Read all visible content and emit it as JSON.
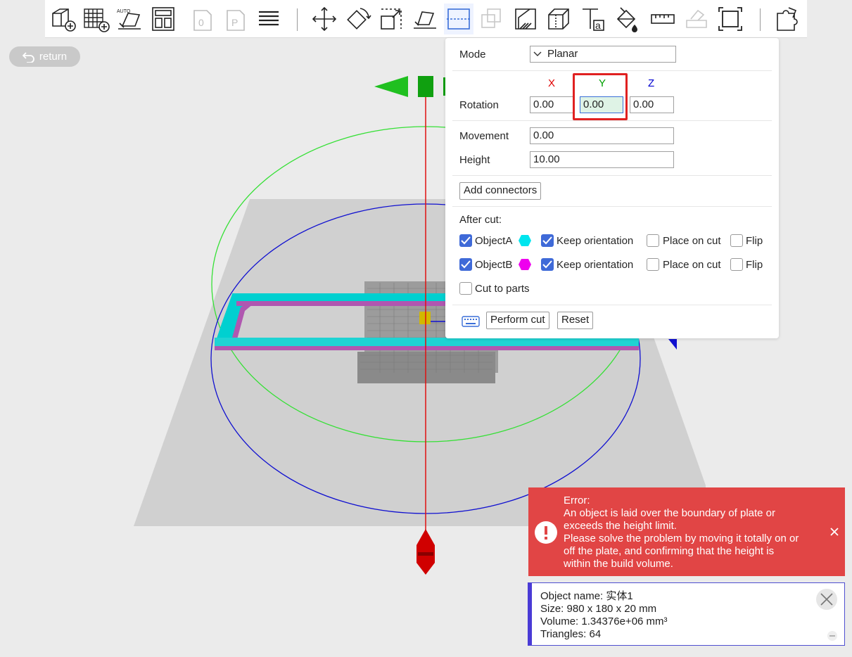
{
  "return_label": "return",
  "cut_panel": {
    "mode_label": "Mode",
    "mode_value": "Planar",
    "axes": {
      "x": "X",
      "y": "Y",
      "z": "Z"
    },
    "axis_colors": {
      "x": "#e00000",
      "y": "#00a000",
      "z": "#0000d0"
    },
    "rotation_label": "Rotation",
    "rotation": {
      "x": "0.00",
      "y": "0.00",
      "z": "0.00"
    },
    "movement_label": "Movement",
    "movement_value": "0.00",
    "height_label": "Height",
    "height_value": "10.00",
    "add_connectors": "Add connectors",
    "after_cut_label": "After cut:",
    "object_a": "ObjectA",
    "object_b": "ObjectB",
    "object_a_color": "#00e5ee",
    "object_b_color": "#ee00ee",
    "keep_orientation": "Keep orientation",
    "place_on_cut": "Place on cut",
    "flip": "Flip",
    "cut_to_parts": "Cut to parts",
    "perform_cut": "Perform cut",
    "reset": "Reset"
  },
  "error": {
    "title": "Error:",
    "line1": "An object is laid over the boundary of plate or",
    "line2": "exceeds the height limit.",
    "line3": "Please solve the problem by moving it totally on or",
    "line4": "off the plate, and confirming that the height is",
    "line5": "within the build volume.",
    "icon": "exclamation-icon",
    "color": "#e14545"
  },
  "object_info": {
    "name": "Object name: 实体1",
    "size": "Size: 980 x 180 x 20 mm",
    "volume": "Volume: 1.34376e+06 mm³",
    "triangles": "Triangles: 64"
  },
  "toolbar_icons": [
    "add-object-icon",
    "add-plate-icon",
    "auto-orient-icon",
    "arrange-icon",
    "layer-0-icon",
    "layer-p-icon",
    "layers-icon",
    "move-icon",
    "rotate-icon",
    "scale-icon",
    "lay-on-face-icon",
    "cut-icon",
    "boolean-icon",
    "support-paint-icon",
    "seam-paint-icon",
    "text-icon",
    "color-paint-icon",
    "measure-icon",
    "assembly-icon",
    "fit-view-icon",
    "split-parts-icon"
  ]
}
